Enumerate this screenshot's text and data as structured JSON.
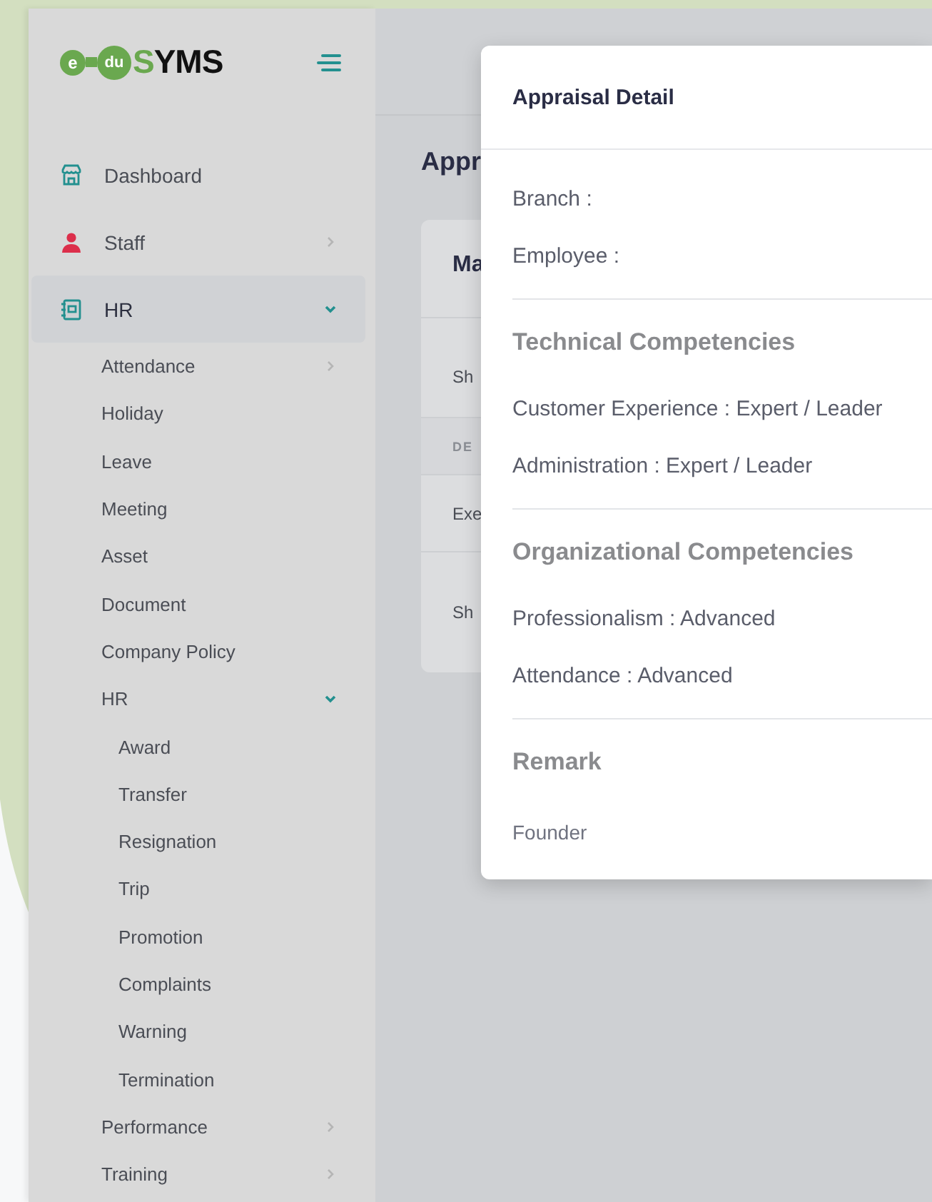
{
  "logo": {
    "bubble_1": "e",
    "bubble_2": "du",
    "text": "SYMS"
  },
  "sidebar": {
    "items": [
      {
        "label": "Dashboard",
        "selected": false
      },
      {
        "label": "Staff",
        "selected": false,
        "expanded": false
      },
      {
        "label": "HR",
        "selected": true,
        "expanded": true,
        "children": [
          {
            "label": "Attendance",
            "selected": false,
            "expanded": false
          },
          {
            "label": "Holiday",
            "selected": false
          },
          {
            "label": "Leave",
            "selected": false
          },
          {
            "label": "Meeting",
            "selected": false
          },
          {
            "label": "Asset",
            "selected": false
          },
          {
            "label": "Document",
            "selected": false
          },
          {
            "label": "Company Policy",
            "selected": false
          },
          {
            "label": "HR",
            "selected": false,
            "expanded": true,
            "children": [
              {
                "label": "Award",
                "selected": false
              },
              {
                "label": "Transfer",
                "selected": false
              },
              {
                "label": "Resignation",
                "selected": false
              },
              {
                "label": "Trip",
                "selected": false
              },
              {
                "label": "Promotion",
                "selected": false
              },
              {
                "label": "Complaints",
                "selected": false
              },
              {
                "label": "Warning",
                "selected": false
              },
              {
                "label": "Termination",
                "selected": false
              }
            ]
          },
          {
            "label": "Performance",
            "selected": false,
            "expanded": false
          },
          {
            "label": "Training",
            "selected": false,
            "expanded": false
          }
        ]
      }
    ]
  },
  "page": {
    "title": "Appr",
    "card": {
      "title": "Ma",
      "line": "Sh",
      "table": {
        "columns": [
          "DE"
        ],
        "rows": [
          [
            "Exe"
          ]
        ]
      },
      "footer": "Sh"
    }
  },
  "modal": {
    "title": "Appraisal Detail",
    "fields": [
      "Branch :",
      "Employee :"
    ],
    "sections": [
      {
        "heading": "Technical Competencies",
        "items": [
          "Customer Experience : Expert / Leader",
          "Administration : Expert / Leader"
        ]
      },
      {
        "heading": "Organizational Competencies",
        "items": [
          "Professionalism : Advanced",
          "Attendance : Advanced"
        ]
      },
      {
        "heading": "Remark",
        "items": [
          "Founder"
        ]
      }
    ]
  }
}
